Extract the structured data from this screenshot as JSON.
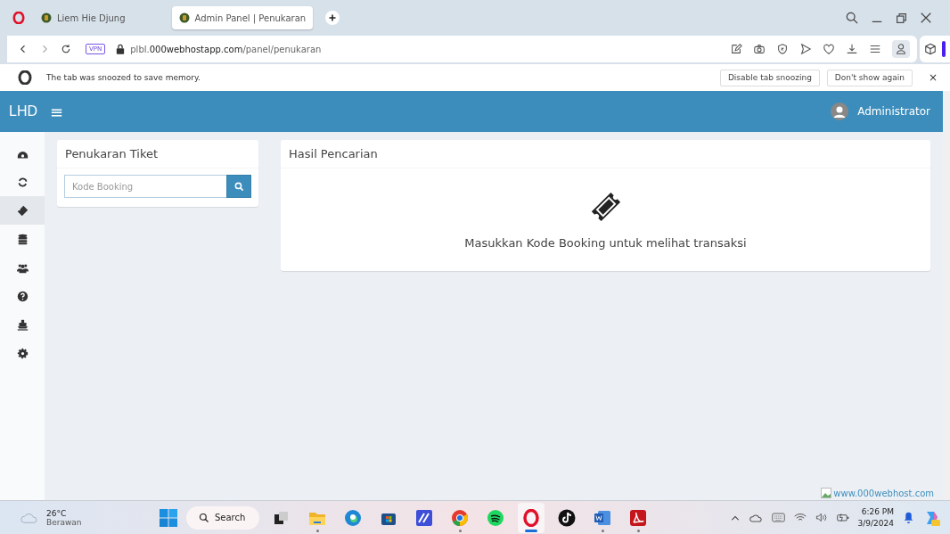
{
  "browser": {
    "tabs": [
      {
        "title": "Liem Hie Djung",
        "selected": false
      },
      {
        "title": "Admin Panel | Penukaran",
        "selected": true
      }
    ],
    "address": {
      "host": "plbl.",
      "domain": "000webhostapp.com",
      "path": "/panel/penukaran"
    },
    "vpn_badge": "VPN",
    "snooze_bar": {
      "message": "The tab was snoozed to save memory.",
      "buttons": [
        "Disable tab snoozing",
        "Don't show again"
      ],
      "close": "×"
    }
  },
  "app": {
    "brand": "LHD",
    "menu_toggle": "≡",
    "user": "Administrator",
    "sidebar": [
      {
        "kind": "dashboard",
        "selected": false
      },
      {
        "kind": "refresh",
        "selected": false
      },
      {
        "kind": "ticket",
        "selected": true
      },
      {
        "kind": "database",
        "selected": false
      },
      {
        "kind": "users",
        "selected": false
      },
      {
        "kind": "help",
        "selected": false
      },
      {
        "kind": "ship",
        "selected": false
      },
      {
        "kind": "settings",
        "selected": false
      }
    ],
    "exchange_card": {
      "title": "Penukaran Tiket",
      "placeholder": "Kode Booking"
    },
    "results_card": {
      "title": "Hasil Pencarian",
      "message": "Masukkan Kode Booking untuk melihat transaksi"
    },
    "broken_image_alt": "www.000webhost.com"
  },
  "taskbar": {
    "weather": {
      "temp": "26°C",
      "condition": "Berawan"
    },
    "search": "Search",
    "apps": [
      {
        "kind": "taskview",
        "open": false,
        "active": false
      },
      {
        "kind": "explorer",
        "open": true,
        "active": false
      },
      {
        "kind": "edge",
        "open": false,
        "active": false
      },
      {
        "kind": "store",
        "open": false,
        "active": false
      },
      {
        "kind": "editor",
        "open": false,
        "active": false
      },
      {
        "kind": "chrome",
        "open": true,
        "active": false
      },
      {
        "kind": "spotify",
        "open": false,
        "active": false
      },
      {
        "kind": "opera",
        "open": true,
        "active": true
      },
      {
        "kind": "tiktok",
        "open": false,
        "active": false
      },
      {
        "kind": "word",
        "open": true,
        "active": false
      },
      {
        "kind": "acrobat",
        "open": true,
        "active": false
      }
    ],
    "time": "6:26 PM",
    "date": "3/9/2024"
  }
}
